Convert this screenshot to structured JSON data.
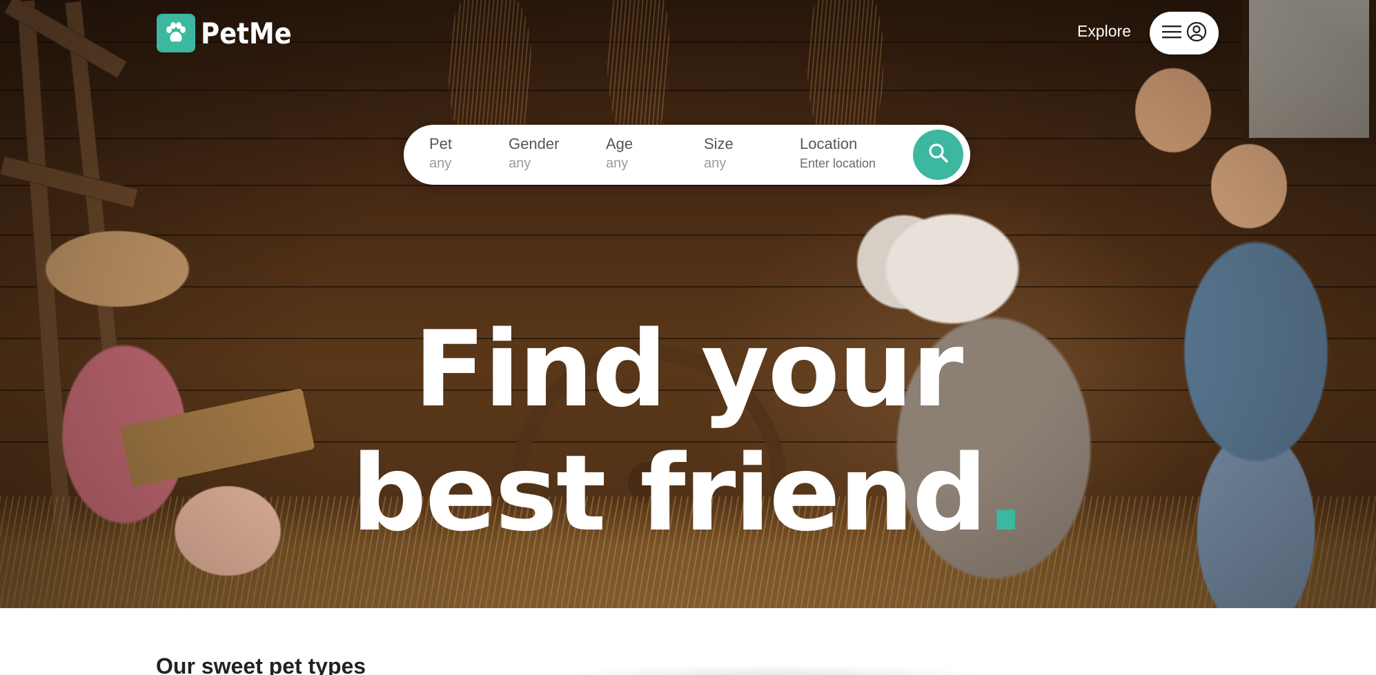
{
  "brand": {
    "name": "PetMe",
    "accent_color": "#3bb89f",
    "logo_icon": "paw-icon"
  },
  "nav": {
    "explore_label": "Explore",
    "menu_icon": "hamburger-icon",
    "account_icon": "user-circle-icon"
  },
  "search": {
    "fields": [
      {
        "label": "Pet",
        "value": "any"
      },
      {
        "label": "Gender",
        "value": "any"
      },
      {
        "label": "Age",
        "value": "any"
      },
      {
        "label": "Size",
        "value": "any"
      },
      {
        "label": "Location",
        "value": "Enter location"
      }
    ],
    "button_icon": "search-icon"
  },
  "hero": {
    "headline_line1": "Find your",
    "headline_line2": "best friend",
    "headline_dot": "."
  },
  "sections": {
    "pet_types_title": "Our sweet pet types"
  }
}
